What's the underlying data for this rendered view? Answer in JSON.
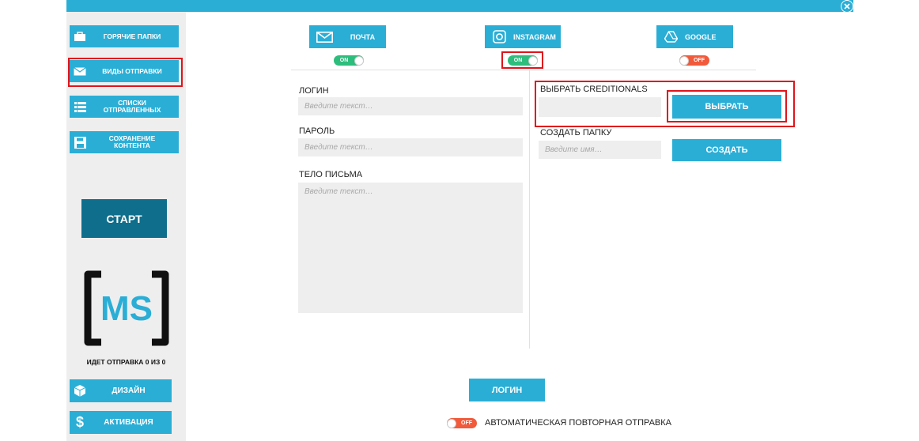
{
  "sidebar": {
    "items": [
      {
        "label": "ГОРЯЧИЕ ПАПКИ",
        "icon": "briefcase-icon"
      },
      {
        "label": "ВИДЫ ОТПРАВКИ",
        "icon": "envelope-icon"
      },
      {
        "label": "СПИСКИ ОТПРАВЛЕННЫХ",
        "icon": "list-icon"
      },
      {
        "label": "СОХРАНЕНИЕ КОНТЕНТА",
        "icon": "floppy-disk-icon"
      }
    ],
    "start_label": "СТАРТ",
    "logo_text": "MS",
    "status_text": "ИДЕТ ОТПРАВКА 0 ИЗ 0",
    "bottom_items": [
      {
        "label": "ДИЗАЙН",
        "icon": "cube-icon"
      },
      {
        "label": "АКТИВАЦИЯ",
        "icon": "dollar-icon"
      }
    ]
  },
  "tabs": [
    {
      "label": "ПОЧТА",
      "icon": "envelope-icon",
      "toggle": "ON"
    },
    {
      "label": "INSTAGRAM",
      "icon": "instagram-icon",
      "toggle": "ON"
    },
    {
      "label": "GOOGLE",
      "icon": "google-drive-icon",
      "toggle": "OFF"
    }
  ],
  "form": {
    "login_label": "ЛОГИН",
    "login_placeholder": "Введите текст…",
    "password_label": "ПАРОЛЬ",
    "password_placeholder": "Введите текст…",
    "body_label": "ТЕЛО ПИСЬМА",
    "body_placeholder": "Введите текст…"
  },
  "credentials": {
    "label": "ВЫБРАТЬ CREDITIONALS",
    "choose_button": "ВЫБРАТЬ",
    "create_folder_label": "СОЗДАТЬ ПАПКУ",
    "folder_placeholder": "Введите имя…",
    "create_button": "СОЗДАТЬ"
  },
  "login_button": "ЛОГИН",
  "auto_resend": {
    "toggle": "OFF",
    "label": "АВТОМАТИЧЕСКАЯ ПОВТОРНАЯ ОТПРАВКА"
  },
  "colors": {
    "accent": "#2aaed6",
    "start": "#0e6e8c",
    "on": "#2dbd7c",
    "off": "#f15a3a",
    "highlight": "#e0141b"
  }
}
